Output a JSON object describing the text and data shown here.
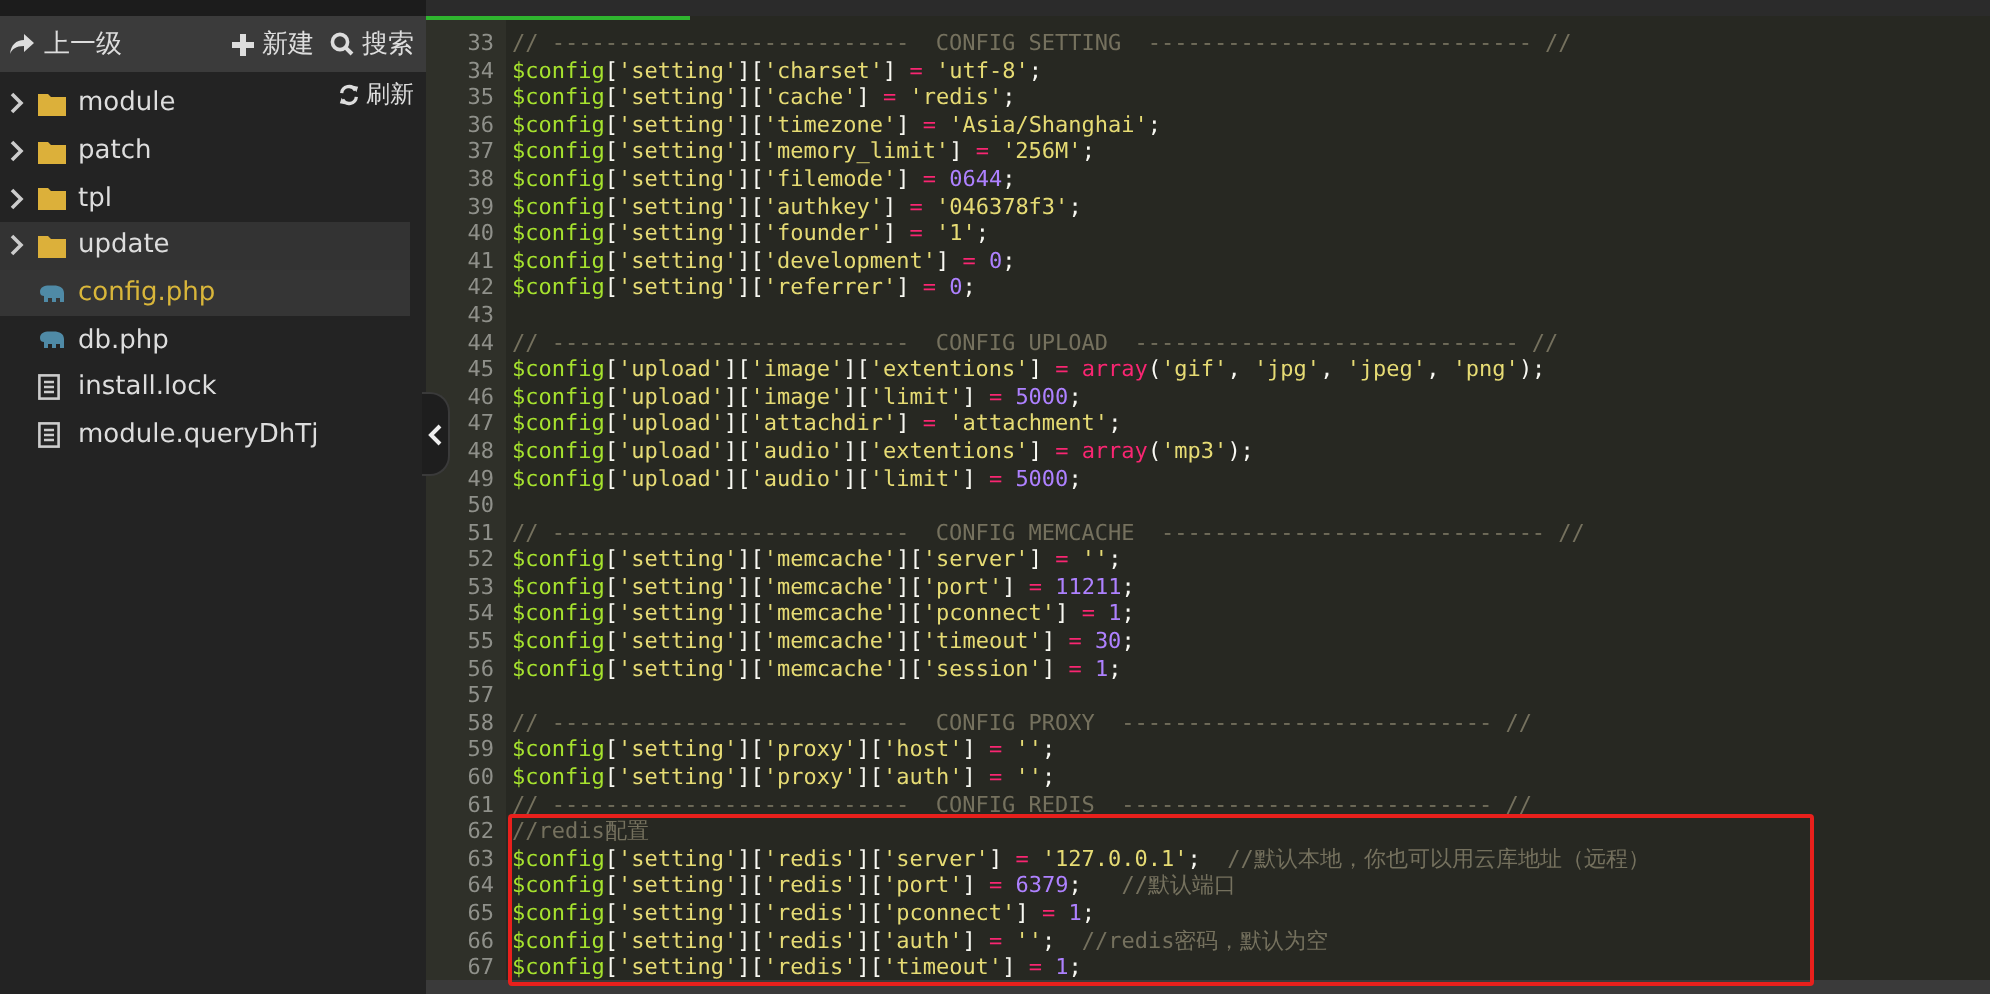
{
  "toolbar": {
    "buttons": [
      {
        "kind": "up",
        "label": "上一级"
      },
      {
        "kind": "new",
        "label": "新建"
      },
      {
        "kind": "search",
        "label": "搜索"
      }
    ],
    "refresh": {
      "label": "刷新"
    }
  },
  "files": [
    {
      "kind": "folder",
      "name": "module",
      "expanded": false,
      "selected": false,
      "hovered": false
    },
    {
      "kind": "folder",
      "name": "patch",
      "expanded": false,
      "selected": false,
      "hovered": false
    },
    {
      "kind": "folder",
      "name": "tpl",
      "expanded": false,
      "selected": false,
      "hovered": false
    },
    {
      "kind": "folder",
      "name": "update",
      "expanded": false,
      "selected": false,
      "hovered": true
    },
    {
      "kind": "php",
      "name": "config.php",
      "selected": true,
      "hovered": false
    },
    {
      "kind": "php",
      "name": "db.php",
      "selected": false,
      "hovered": false
    },
    {
      "kind": "text",
      "name": "install.lock",
      "selected": false,
      "hovered": false
    },
    {
      "kind": "text",
      "name": "module.queryDhTj",
      "selected": false,
      "hovered": false
    }
  ],
  "editor": {
    "sections": [
      {
        "highlighted": false,
        "lines": [
          {
            "number": "33",
            "code": "// ---------------------------  CONFIG SETTING  ----------------------------- //"
          },
          {
            "number": "34",
            "code": "$config['setting']['charset'] = 'utf-8';"
          },
          {
            "number": "35",
            "code": "$config['setting']['cache'] = 'redis';"
          },
          {
            "number": "36",
            "code": "$config['setting']['timezone'] = 'Asia/Shanghai';"
          },
          {
            "number": "37",
            "code": "$config['setting']['memory_limit'] = '256M';"
          },
          {
            "number": "38",
            "code": "$config['setting']['filemode'] = 0644;"
          },
          {
            "number": "39",
            "code": "$config['setting']['authkey'] = '046378f3';"
          },
          {
            "number": "40",
            "code": "$config['setting']['founder'] = '1';"
          },
          {
            "number": "41",
            "code": "$config['setting']['development'] = 0;"
          },
          {
            "number": "42",
            "code": "$config['setting']['referrer'] = 0;"
          },
          {
            "number": "43"
          },
          {
            "number": "44",
            "code": "// ---------------------------  CONFIG UPLOAD  ----------------------------- //"
          },
          {
            "number": "45",
            "code": "$config['upload']['image']['extentions'] = array('gif', 'jpg', 'jpeg', 'png');"
          },
          {
            "number": "46",
            "code": "$config['upload']['image']['limit'] = 5000;"
          },
          {
            "number": "47",
            "code": "$config['upload']['attachdir'] = 'attachment';"
          },
          {
            "number": "48",
            "code": "$config['upload']['audio']['extentions'] = array('mp3');"
          },
          {
            "number": "49",
            "code": "$config['upload']['audio']['limit'] = 5000;"
          },
          {
            "number": "50"
          },
          {
            "number": "51",
            "code": "// ---------------------------  CONFIG MEMCACHE  ----------------------------- //"
          },
          {
            "number": "52",
            "code": "$config['setting']['memcache']['server'] = '';"
          },
          {
            "number": "53",
            "code": "$config['setting']['memcache']['port'] = 11211;"
          },
          {
            "number": "54",
            "code": "$config['setting']['memcache']['pconnect'] = 1;"
          },
          {
            "number": "55",
            "code": "$config['setting']['memcache']['timeout'] = 30;"
          },
          {
            "number": "56",
            "code": "$config['setting']['memcache']['session'] = 1;"
          },
          {
            "number": "57"
          },
          {
            "number": "58",
            "code": "// ---------------------------  CONFIG PROXY  ---------------------------- //"
          },
          {
            "number": "59",
            "code": "$config['setting']['proxy']['host'] = '';"
          },
          {
            "number": "60",
            "code": "$config['setting']['proxy']['auth'] = '';"
          },
          {
            "number": "61",
            "code": "// ---------------------------  CONFIG REDIS  ---------------------------- //"
          }
        ]
      },
      {
        "highlighted": true,
        "lines": [
          {
            "number": "62",
            "code": "//redis配置"
          },
          {
            "number": "63",
            "code": "$config['setting']['redis']['server'] = '127.0.0.1';  //默认本地，你也可以用云库地址（远程）"
          },
          {
            "number": "64",
            "code": "$config['setting']['redis']['port'] = 6379;   //默认端口"
          },
          {
            "number": "65",
            "code": "$config['setting']['redis']['pconnect'] = 1;"
          },
          {
            "number": "66",
            "code": "$config['setting']['redis']['auth'] = '';  //redis密码，默认为空"
          },
          {
            "number": "67",
            "code": "$config['setting']['redis']['timeout'] = 1;"
          }
        ]
      }
    ]
  }
}
